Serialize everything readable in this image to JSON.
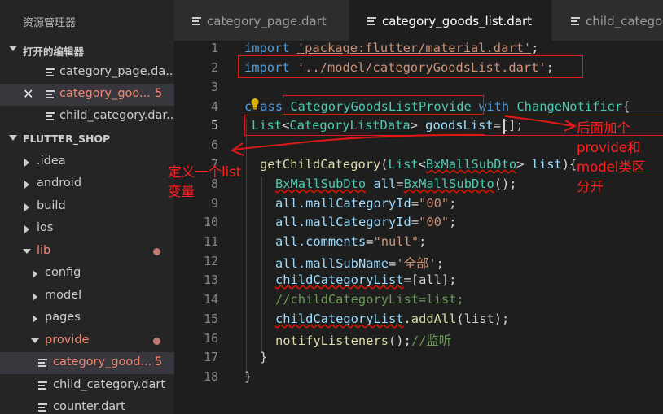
{
  "sidebar": {
    "title": "资源管理器",
    "open_editors": {
      "heading": "打开的编辑器",
      "items": [
        {
          "label": "category_page.da...",
          "badge": ""
        },
        {
          "label": "category_goo...",
          "badge": "5"
        },
        {
          "label": "child_category.dar...",
          "badge": ""
        }
      ]
    },
    "project": {
      "heading": "FLUTTER_SHOP",
      "items": [
        {
          "label": ".idea"
        },
        {
          "label": "android"
        },
        {
          "label": "build"
        },
        {
          "label": "ios"
        },
        {
          "label": "lib"
        },
        {
          "label": "config"
        },
        {
          "label": "model"
        },
        {
          "label": "pages"
        },
        {
          "label": "provide"
        },
        {
          "label": "category_good...",
          "badge": "5"
        },
        {
          "label": "child_category.dart"
        },
        {
          "label": "counter.dart"
        }
      ]
    }
  },
  "tabs": [
    {
      "label": "category_page.dart"
    },
    {
      "label": "category_goods_list.dart"
    },
    {
      "label": "child_categor"
    }
  ],
  "editor": {
    "line_numbers": [
      "1",
      "2",
      "3",
      "4",
      "5",
      "6",
      "7",
      "8",
      "9",
      "10",
      "11",
      "12",
      "13",
      "14",
      "15",
      "16",
      "17",
      "18"
    ],
    "lines": {
      "l1": {
        "kw": "import",
        "str": "'package:flutter/material.dart'",
        "end": ";"
      },
      "l2": {
        "kw": "import",
        "str": "'../model/categoryGoodsList.dart'",
        "end": ";"
      },
      "l4": {
        "kw_a": "c",
        "kw_b": "ass",
        "cls": "CategoryGoodsListProvide",
        "with": "with",
        "mixin": "ChangeNotifier",
        "brace": "{"
      },
      "l5": {
        "type": "List",
        "lt": "<",
        "generic": "CategoryListData",
        "gt": ">",
        "name": " goodsList",
        "rest": "=[];"
      },
      "l7": {
        "fn": "getChildCategory",
        "open": "(",
        "type": "List",
        "lt": "<",
        "generic": "BxMallSubDto",
        "gt": ">",
        "param": " list",
        "close": "){"
      },
      "l8": {
        "type": "BxMallSubDto",
        "name": " all",
        "eq": "=",
        "ctor": "BxMallSubDto",
        "end": "();"
      },
      "l9": {
        "obj": "all",
        "prop": ".mallCategoryId",
        "eq": "=",
        "val": "\"00\"",
        "end": ";"
      },
      "l10": {
        "obj": "all",
        "prop": ".mallCategoryId",
        "eq": "=",
        "val": "\"00\"",
        "end": ";"
      },
      "l11": {
        "obj": "all",
        "prop": ".comments",
        "eq": "=",
        "val": "\"null\"",
        "end": ";"
      },
      "l12": {
        "obj": "all",
        "prop": ".mallSubName",
        "eq": "=",
        "val": "'全部'",
        "end": ";"
      },
      "l13": {
        "var": "childCategoryList",
        "rest": "=[all];"
      },
      "l14": {
        "comment": "//childCategoryList=list;"
      },
      "l15": {
        "var": "childCategoryList",
        "fn": ".addAll",
        "rest": "(list);"
      },
      "l16": {
        "fn": "notifyListeners",
        "rest": "();",
        "comment": "//监听"
      },
      "l17": {
        "text": "}"
      },
      "l18": {
        "text": "}"
      }
    }
  },
  "annotations": {
    "note_right": [
      "后面加个",
      "provide和",
      "model类区",
      "分开"
    ],
    "note_left": [
      "定义一个list",
      "变量"
    ],
    "color": "#ff2020"
  }
}
